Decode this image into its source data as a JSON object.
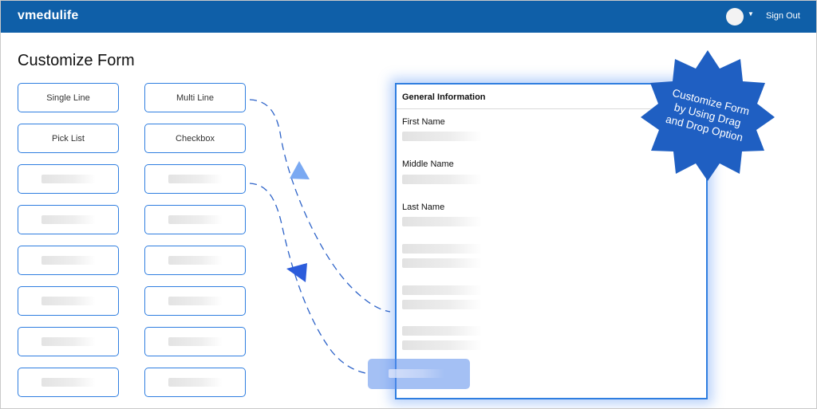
{
  "header": {
    "brand": "vmedulife",
    "signout_label": "Sign Out",
    "icons": {
      "avatar": "user-avatar-icon",
      "caret": "chevron-down-icon"
    }
  },
  "page": {
    "title": "Customize Form"
  },
  "palette": {
    "left": [
      {
        "label": "Single Line"
      },
      {
        "label": "Multi Line"
      },
      {
        "label": "Pick List"
      },
      {
        "label": "Checkbox"
      },
      {
        "label": ""
      },
      {
        "label": ""
      },
      {
        "label": ""
      },
      {
        "label": ""
      },
      {
        "label": ""
      },
      {
        "label": ""
      },
      {
        "label": ""
      },
      {
        "label": ""
      },
      {
        "label": ""
      },
      {
        "label": ""
      },
      {
        "label": ""
      },
      {
        "label": ""
      }
    ]
  },
  "form": {
    "section_title": "General Information",
    "fields": [
      {
        "label": "First Name"
      },
      {
        "label": "Middle Name"
      },
      {
        "label": "Last Name"
      }
    ]
  },
  "badge": {
    "lines": [
      "Customize Form",
      "by Using Drag",
      "and Drop Option"
    ]
  },
  "colors": {
    "header": "#0f5fa8",
    "accent": "#2f7ee0",
    "badge": "#1f5fc2"
  }
}
